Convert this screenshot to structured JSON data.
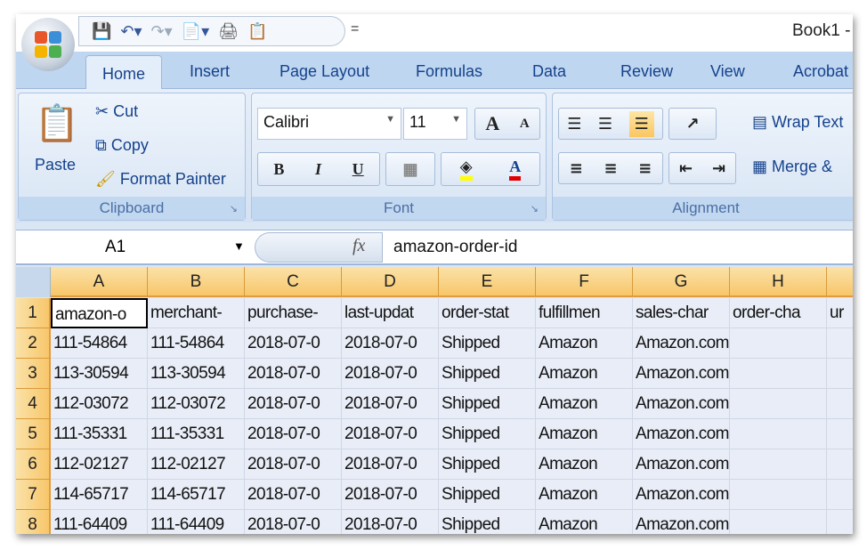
{
  "window": {
    "title": "Book1 -"
  },
  "quick_access": {
    "icons": [
      "save-icon",
      "undo-icon",
      "redo-icon",
      "print-preview-icon",
      "print-icon",
      "paste-special-icon"
    ],
    "more": "="
  },
  "tabs": [
    "Home",
    "Insert",
    "Page Layout",
    "Formulas",
    "Data",
    "Review",
    "View",
    "Acrobat"
  ],
  "active_tab": "Home",
  "clipboard": {
    "label": "Clipboard",
    "paste": "Paste",
    "cut": "Cut",
    "copy": "Copy",
    "format_painter": "Format Painter"
  },
  "font": {
    "label": "Font",
    "name": "Calibri",
    "size": "11",
    "bold": "B",
    "italic": "I",
    "underline": "U",
    "grow": "A",
    "shrink": "A",
    "font_color": "A",
    "highlight_color": "#ffff00",
    "text_color": "#e00000"
  },
  "alignment": {
    "label": "Alignment",
    "wrap_text": "Wrap Text",
    "merge": "Merge &",
    "active": "bottom-align"
  },
  "formula_bar": {
    "name_box": "A1",
    "fx": "fx",
    "value": "amazon-order-id"
  },
  "columns": [
    "A",
    "B",
    "C",
    "D",
    "E",
    "F",
    "G",
    "H"
  ],
  "rows": [
    [
      "amazon-o",
      "merchant-",
      "purchase-",
      "last-updat",
      "order-stat",
      "fulfillmen",
      "sales-char",
      "order-cha",
      "ur"
    ],
    [
      "111-54864",
      "111-54864",
      "2018-07-0",
      "2018-07-0",
      "Shipped",
      "Amazon",
      "Amazon.com",
      "",
      ""
    ],
    [
      "113-30594",
      "113-30594",
      "2018-07-0",
      "2018-07-0",
      "Shipped",
      "Amazon",
      "Amazon.com",
      "",
      ""
    ],
    [
      "112-03072",
      "112-03072",
      "2018-07-0",
      "2018-07-0",
      "Shipped",
      "Amazon",
      "Amazon.com",
      "",
      ""
    ],
    [
      "111-35331",
      "111-35331",
      "2018-07-0",
      "2018-07-0",
      "Shipped",
      "Amazon",
      "Amazon.com",
      "",
      ""
    ],
    [
      "112-02127",
      "112-02127",
      "2018-07-0",
      "2018-07-0",
      "Shipped",
      "Amazon",
      "Amazon.com",
      "",
      ""
    ],
    [
      "114-65717",
      "114-65717",
      "2018-07-0",
      "2018-07-0",
      "Shipped",
      "Amazon",
      "Amazon.com",
      "",
      ""
    ],
    [
      "111-64409",
      "111-64409",
      "2018-07-0",
      "2018-07-0",
      "Shipped",
      "Amazon",
      "Amazon.com",
      "",
      ""
    ]
  ],
  "row_numbers": [
    "1",
    "2",
    "3",
    "4",
    "5",
    "6",
    "7",
    "8"
  ]
}
